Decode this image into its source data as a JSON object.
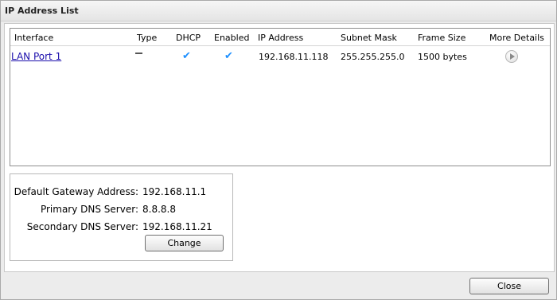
{
  "window": {
    "title": "IP Address List"
  },
  "table": {
    "headers": {
      "interface": "Interface",
      "type": "Type",
      "dhcp": "DHCP",
      "enabled": "Enabled",
      "ip_address": "IP Address",
      "subnet_mask": "Subnet Mask",
      "frame_size": "Frame Size",
      "more_details": "More Details"
    },
    "rows": [
      {
        "interface": "LAN Port 1",
        "type_icon": "dash-icon",
        "dhcp": true,
        "enabled": true,
        "ip_address": "192.168.11.118",
        "subnet_mask": "255.255.255.0",
        "frame_size": "1500 bytes",
        "more_details_icon": "play-icon"
      }
    ]
  },
  "network": {
    "gateway_label": "Default Gateway Address:",
    "gateway_value": "192.168.11.1",
    "primary_dns_label": "Primary DNS Server:",
    "primary_dns_value": "8.8.8.8",
    "secondary_dns_label": "Secondary DNS Server:",
    "secondary_dns_value": "192.168.11.21",
    "change_label": "Change"
  },
  "footer": {
    "close_label": "Close"
  },
  "icons": {
    "check": "✔",
    "check_color": "#1e90ff"
  }
}
